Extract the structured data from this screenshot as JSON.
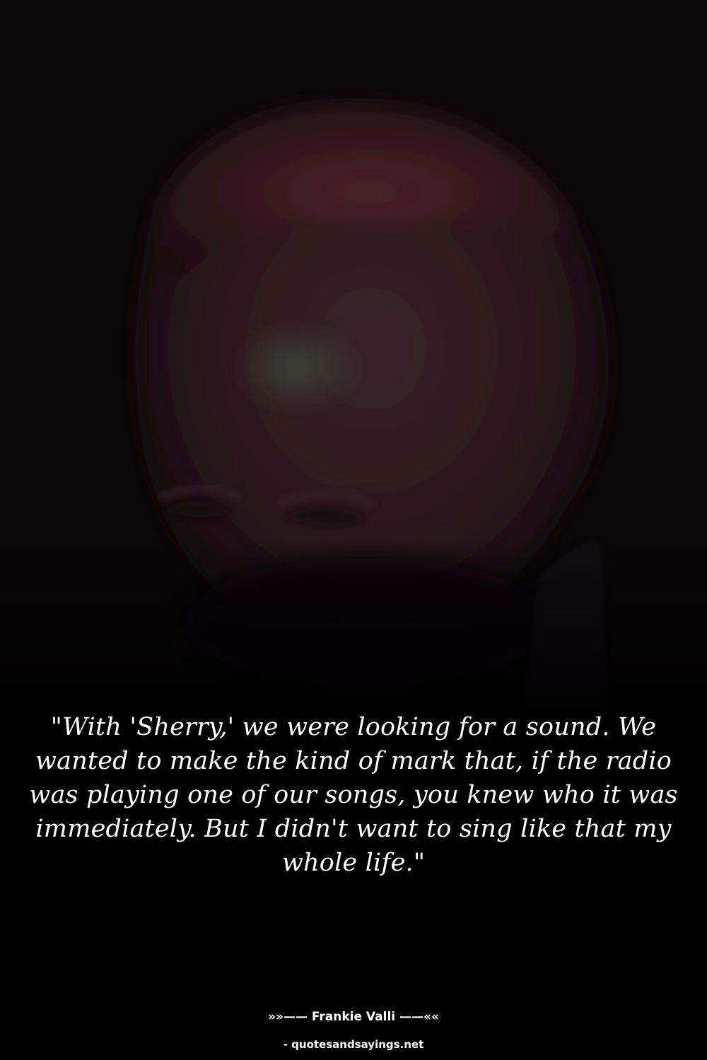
{
  "quote": {
    "text": "\"With 'Sherry,' we were looking for a sound. We wanted to make the kind of mark that, if the radio was playing one of our songs, you knew who it was immediately. But I didn't want to sing like that my whole life.\"",
    "author_line": "»»—— Frankie Valli ——««",
    "source": "- quotesandsayings.net"
  },
  "colors": {
    "background": "#000000",
    "text": "#ffffff",
    "tint": "#5a2a2e"
  }
}
